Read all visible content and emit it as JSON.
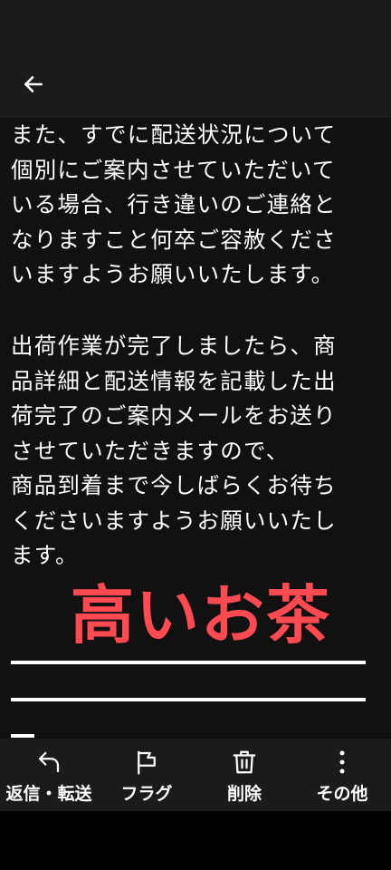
{
  "header": {
    "back_icon": "arrow-left-icon"
  },
  "message": {
    "paragraph_1": "また、すでに配送状況について\n個別にご案内させていただいて\nいる場合、行き違いのご連絡と\nなりますこと何卒ご容赦くださ\nいますようお願いいたします。",
    "paragraph_2": "出荷作業が完了しましたら、商\n品詳細と配送情報を記載した出\n荷完了のご案内メールをお送り\nさせていただきますので、\n商品到着まで今しばらくお待ち\nくださいますようお願いいたし\nます。",
    "overlay_text": "高いお茶",
    "overlay_color": "#ff4a52"
  },
  "actions": [
    {
      "label": "返信・転送",
      "icon": "reply-icon"
    },
    {
      "label": "フラグ",
      "icon": "flag-icon"
    },
    {
      "label": "削除",
      "icon": "trash-icon"
    },
    {
      "label": "その他",
      "icon": "more-vertical-icon"
    }
  ]
}
